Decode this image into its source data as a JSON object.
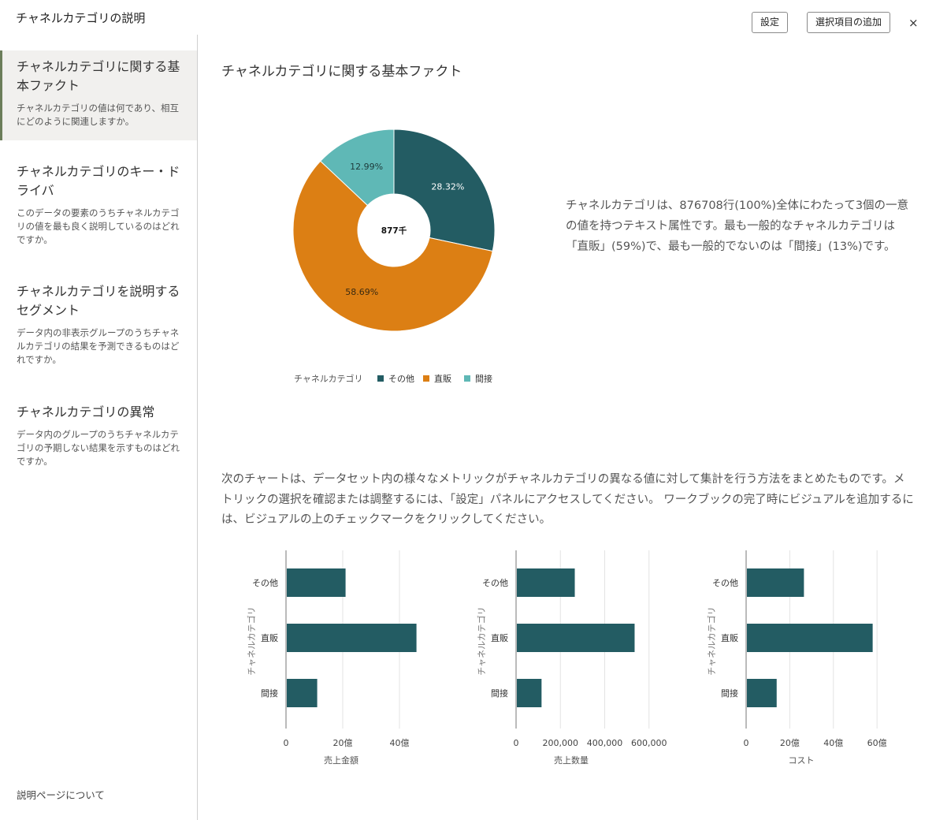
{
  "header": {
    "title": "チャネルカテゴリの説明",
    "settings_label": "設定",
    "add_selection_label": "選択項目の追加",
    "close_symbol": "×"
  },
  "sidebar": {
    "items": [
      {
        "title": "チャネルカテゴリに関する基本ファクト",
        "desc": "チャネルカテゴリの値は何であり、相互にどのように関連しますか。"
      },
      {
        "title": "チャネルカテゴリのキー・ドライバ",
        "desc": "このデータの要素のうちチャネルカテゴリの値を最も良く説明しているのはどれですか。"
      },
      {
        "title": "チャネルカテゴリを説明するセグメント",
        "desc": "データ内の非表示グループのうちチャネルカテゴリの結果を予測できるものはどれですか。"
      },
      {
        "title": "チャネルカテゴリの異常",
        "desc": "データ内のグループのうちチャネルカテゴリの予期しない結果を示すものはどれですか。"
      }
    ],
    "about_label": "説明ページについて"
  },
  "main": {
    "section_title": "チャネルカテゴリに関する基本ファクト",
    "summary": "チャネルカテゴリは、876708行(100%)全体にわたって3個の一意の値を持つテキスト属性です。最も一般的なチャネルカテゴリは「直販」(59%)で、最も一般的でないのは「間接」(13%)です。",
    "intro": "次のチャートは、データセット内の様々なメトリックがチャネルカテゴリの異なる値に対して集計を行う方法をまとめたものです。メトリックの選択を確認または調整するには、「設定」パネルにアクセスしてください。 ワークブックの完了時にビジュアルを追加するには、ビジュアルの上のチェックマークをクリックしてください。"
  },
  "colors": {
    "dark_teal": "#235c63",
    "orange": "#dc7f14",
    "light_teal": "#5fb8b6"
  },
  "chart_data": [
    {
      "type": "pie",
      "center_label": "877千",
      "legend_title": "チャネルカテゴリ",
      "slices": [
        {
          "name": "その他",
          "value": 28.32,
          "label": "28.32%",
          "color": "#235c63"
        },
        {
          "name": "直販",
          "value": 58.69,
          "label": "58.69%",
          "color": "#dc7f14"
        },
        {
          "name": "間接",
          "value": 12.99,
          "label": "12.99%",
          "color": "#5fb8b6"
        }
      ]
    },
    {
      "type": "bar",
      "orientation": "horizontal",
      "categories": [
        "その他",
        "直販",
        "間接"
      ],
      "values": [
        21,
        46,
        11
      ],
      "xlabel": "売上金額",
      "ylabel": "チャネルカテゴリ",
      "xlim": [
        0,
        50
      ],
      "ticks": [
        0,
        20,
        40
      ],
      "tick_labels": [
        "0",
        "20億",
        "40億"
      ],
      "grid": true,
      "color": "#235c63"
    },
    {
      "type": "bar",
      "orientation": "horizontal",
      "categories": [
        "その他",
        "直販",
        "間接"
      ],
      "values": [
        265000,
        535000,
        115000
      ],
      "xlabel": "売上数量",
      "ylabel": "チャネルカテゴリ",
      "xlim": [
        0,
        640000
      ],
      "ticks": [
        0,
        200000,
        400000,
        600000
      ],
      "tick_labels": [
        "0",
        "200,000",
        "400,000",
        "600,000"
      ],
      "grid": true,
      "color": "#235c63"
    },
    {
      "type": "bar",
      "orientation": "horizontal",
      "categories": [
        "その他",
        "直販",
        "間接"
      ],
      "values": [
        26.5,
        58,
        14
      ],
      "xlabel": "コスト",
      "ylabel": "チャネルカテゴリ",
      "xlim": [
        0,
        65
      ],
      "ticks": [
        0,
        20,
        40,
        60
      ],
      "tick_labels": [
        "0",
        "20億",
        "40億",
        "60億"
      ],
      "grid": true,
      "color": "#235c63"
    }
  ]
}
